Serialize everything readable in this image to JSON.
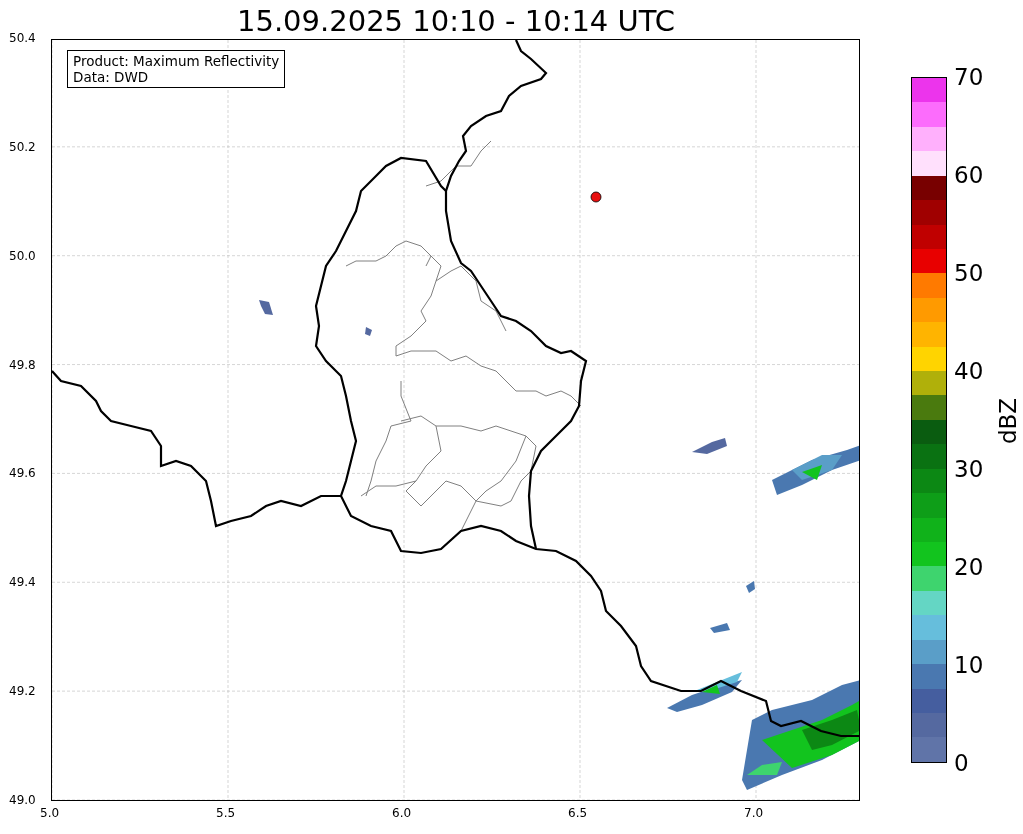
{
  "title": "15.09.2025 10:10 - 10:14 UTC",
  "info_box": [
    "Product: Maximum Reflectivity",
    "Data: DWD"
  ],
  "x_ticks": [
    "5.0",
    "5.5",
    "6.0",
    "6.5",
    "7.0"
  ],
  "y_ticks": [
    "50.4",
    "50.2",
    "50.0",
    "49.8",
    "49.6",
    "49.4",
    "49.2",
    "49.0"
  ],
  "colorbar": {
    "label": "dBZ",
    "ticks": [
      "70",
      "60",
      "50",
      "40",
      "30",
      "20",
      "10",
      "0"
    ],
    "bands": [
      {
        "color": "#ec34ec"
      },
      {
        "color": "#fc6cfc"
      },
      {
        "color": "#ffb0fc"
      },
      {
        "color": "#ffe0fc"
      },
      {
        "color": "#780000"
      },
      {
        "color": "#a00000"
      },
      {
        "color": "#c00000"
      },
      {
        "color": "#e80000"
      },
      {
        "color": "#ff7a00"
      },
      {
        "color": "#ff9a00"
      },
      {
        "color": "#ffb400"
      },
      {
        "color": "#ffd400"
      },
      {
        "color": "#b0b00a"
      },
      {
        "color": "#4a7a0e"
      },
      {
        "color": "#0a5c10"
      },
      {
        "color": "#0a7212"
      },
      {
        "color": "#0c8814"
      },
      {
        "color": "#0e9e18"
      },
      {
        "color": "#10b21a"
      },
      {
        "color": "#12c41e"
      },
      {
        "color": "#3ed46e"
      },
      {
        "color": "#64d6c4"
      },
      {
        "color": "#66bedc"
      },
      {
        "color": "#5a9ec8"
      },
      {
        "color": "#4a78b0"
      },
      {
        "color": "#455e9f"
      },
      {
        "color": "#5569a0"
      },
      {
        "color": "#6074a8"
      }
    ]
  }
}
